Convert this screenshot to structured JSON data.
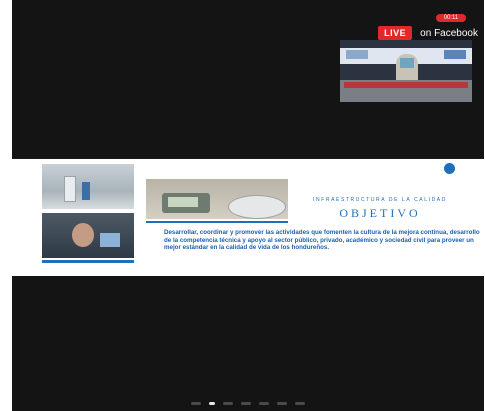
{
  "live": {
    "badge": "LIVE",
    "text": "on Facebook",
    "viewer_pill": "00:11",
    "badge_color": "#e02a2a"
  },
  "slide": {
    "subtitle": "INFRAESTRUCTURA DE LA CALIDAD",
    "title": "OBJETIVO",
    "body": "Desarrollar, coordinar y promover las actividades que fomenten la cultura de la mejora continua, desarrollo de la competencia técnica y apoyo al sector público, privado, académico y sociedad civil para proveer un mejor estándar en la calidad de vida de los hondureños.",
    "accent_color": "#1f6fbf"
  },
  "pager": {
    "count": 7,
    "active_index": 1
  }
}
